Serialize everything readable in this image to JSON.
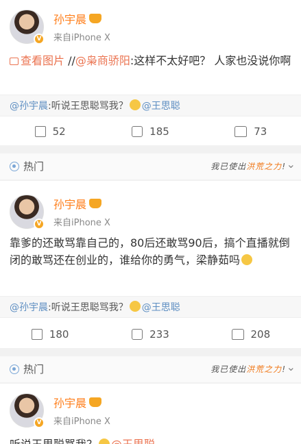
{
  "posts": [
    {
      "username": "孙宇晨",
      "source": "来自iPhone X",
      "view_pic": "查看图片",
      "body_sep": " //",
      "mention": "@枭商骄阳",
      "body": ":这样不太好吧？  人家也没说你啊",
      "retweet_prefix": "@孙宇晨",
      "retweet_text": ":听说王思聪骂我？",
      "retweet_mention": "@王思聪",
      "repost_count": "52",
      "comment_count": "185",
      "like_count": "73"
    },
    {
      "username": "孙宇晨",
      "source": "来自iPhone X",
      "body": "靠爹的还敢骂靠自己的，80后还敢骂90后，搞个直播就倒闭的敢骂还在创业的，谁给你的勇气，梁静茹吗",
      "retweet_prefix": "@孙宇晨",
      "retweet_text": ":听说王思聪骂我？",
      "retweet_mention": "@王思聪",
      "repost_count": "180",
      "comment_count": "233",
      "like_count": "208"
    },
    {
      "username": "孙宇晨",
      "source": "来自iPhone X",
      "body_partial": "听说王思聪骂我？",
      "mention_partial": "@王思聪"
    }
  ],
  "hot_label": "热门",
  "banner": {
    "part1": "我已使出",
    "part2": "洪荒之力",
    "part3": "!"
  },
  "icons": {
    "repost": "repost-icon",
    "comment": "comment-icon",
    "like": "like-icon",
    "hot": "hot-icon",
    "more": "chevron-down-icon"
  },
  "colors": {
    "username": "#ff7e1a",
    "link": "#eb7350",
    "retweet_link": "#5d8ec2",
    "banner_accent": "#f07a1c"
  }
}
